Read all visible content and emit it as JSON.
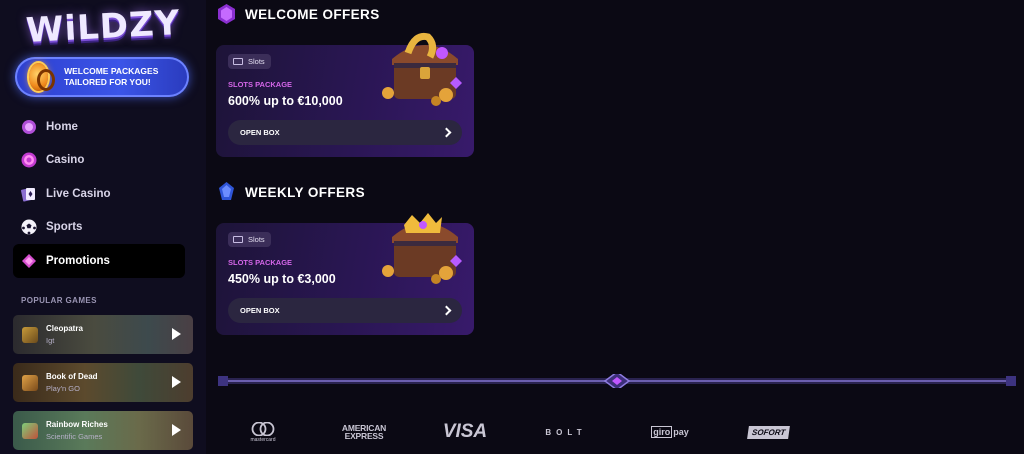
{
  "brand": {
    "logo_text": "WiLDZY"
  },
  "promo_banner": {
    "text": "WELCOME PACKAGES TAILORED FOR YOU!"
  },
  "sidebar": {
    "items": [
      {
        "label": "Home",
        "icon": "home-icon",
        "active": false
      },
      {
        "label": "Casino",
        "icon": "casino-chip-icon",
        "active": false
      },
      {
        "label": "Live Casino",
        "icon": "playing-cards-icon",
        "active": false
      },
      {
        "label": "Sports",
        "icon": "soccer-ball-icon",
        "active": false
      },
      {
        "label": "Promotions",
        "icon": "diamond-gem-icon",
        "active": true
      }
    ],
    "popular_games_label": "POPULAR GAMES",
    "games": [
      {
        "name": "Cleopatra",
        "provider": "Igt"
      },
      {
        "name": "Book of Dead",
        "provider": "Play'n GO"
      },
      {
        "name": "Rainbow Riches",
        "provider": "Scientific Games"
      }
    ]
  },
  "welcome": {
    "title": "WELCOME OFFERS",
    "card": {
      "tag": "Slots",
      "subtitle": "SLOTS PACKAGE",
      "amount": "600% up to €10,000",
      "button": "OPEN BOX"
    }
  },
  "weekly": {
    "title": "WEEKLY OFFERS",
    "card": {
      "tag": "Slots",
      "subtitle": "SLOTS PACKAGE",
      "amount": "450% up to €3,000",
      "button": "OPEN BOX"
    }
  },
  "payments": {
    "mastercard": "mastercard",
    "amex": [
      "AMERICAN",
      "EXPRESS"
    ],
    "visa": "VISA",
    "bolt": "BOLT",
    "giropay_a": "giro",
    "giropay_b": "pay",
    "sofort": "SOFORT"
  },
  "colors": {
    "accent": "#d466e8",
    "sidebar_bg": "#0f0d1f",
    "page_bg": "#0b0914",
    "banner": "#3b55e8"
  }
}
